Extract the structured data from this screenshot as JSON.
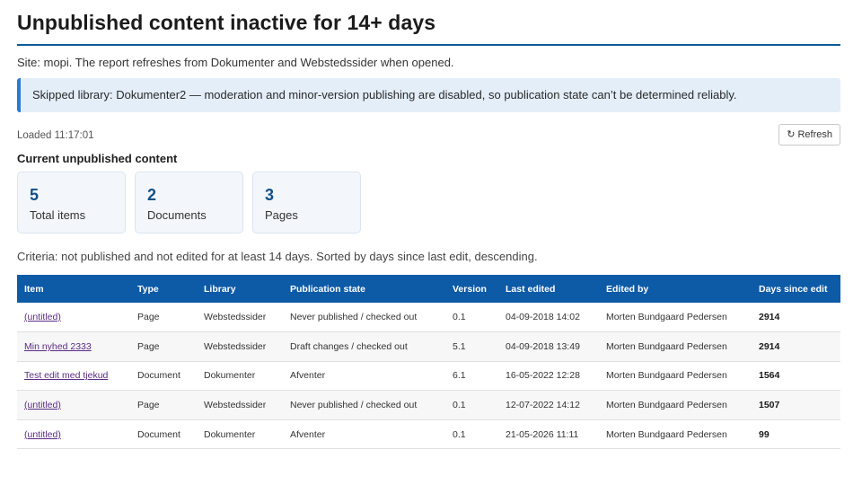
{
  "title": "Unpublished content inactive for 14+ days",
  "site_line": "Site: mopi. The report refreshes from Dokumenter and Webstedssider when opened.",
  "notice": "Skipped library: Dokumenter2 — moderation and minor-version publishing are disabled, so publication state can’t be determined reliably.",
  "loaded": "Loaded 11:17:01",
  "refresh_label": "Refresh",
  "refresh_icon": "↻",
  "section_heading": "Current unpublished content",
  "cards": [
    {
      "num": "5",
      "label": "Total items"
    },
    {
      "num": "2",
      "label": "Documents"
    },
    {
      "num": "3",
      "label": "Pages"
    }
  ],
  "criteria": "Criteria: not published and not edited for at least 14 days. Sorted by days since last edit, descending.",
  "table": {
    "headers": [
      "Item",
      "Type",
      "Library",
      "Publication state",
      "Version",
      "Last edited",
      "Edited by",
      "Days since edit"
    ],
    "rows": [
      [
        "(untitled)",
        "Page",
        "Webstedssider",
        "Never published / checked out",
        "0.1",
        "04-09-2018 14:02",
        "Morten Bundgaard Pedersen",
        "2914"
      ],
      [
        "Min nyhed 2333",
        "Page",
        "Webstedssider",
        "Draft changes / checked out",
        "5.1",
        "04-09-2018 13:49",
        "Morten Bundgaard Pedersen",
        "2914"
      ],
      [
        "Test edit med tjekud",
        "Document",
        "Dokumenter",
        "Afventer",
        "6.1",
        "16-05-2022 12:28",
        "Morten Bundgaard Pedersen",
        "1564"
      ],
      [
        "(untitled)",
        "Page",
        "Webstedssider",
        "Never published / checked out",
        "0.1",
        "12-07-2022 14:12",
        "Morten Bundgaard Pedersen",
        "1507"
      ],
      [
        "(untitled)",
        "Document",
        "Dokumenter",
        "Afventer",
        "0.1",
        "21-05-2026 11:11",
        "Morten Bundgaard Pedersen",
        "99"
      ]
    ]
  },
  "colors": {
    "accent": "#0d5aa7",
    "notice_bg": "#e3eef9",
    "link": "#5b2c83"
  }
}
